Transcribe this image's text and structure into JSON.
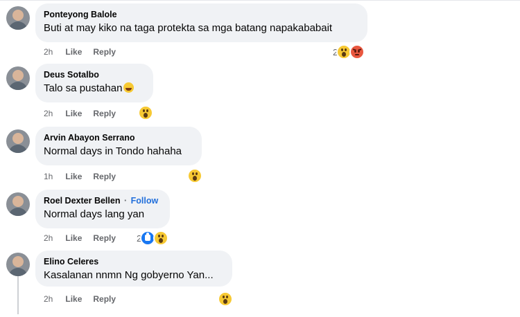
{
  "comments": [
    {
      "author": "Ponteyong Balole",
      "text": "Buti at may kiko na taga protekta sa mga batang napakababait",
      "time": "2h",
      "like": "Like",
      "reply": "Reply",
      "reaction_count": "2",
      "reactions": [
        "wow-emoji-icon",
        "angry-emoji-icon"
      ]
    },
    {
      "author": "Deus Sotalbo",
      "text": "Talo sa pustahan",
      "text_emoji": "laughing-emoji-icon",
      "time": "2h",
      "like": "Like",
      "reply": "Reply",
      "reactions": [
        "wow-emoji-icon"
      ]
    },
    {
      "author": "Arvin Abayon Serrano",
      "text": "Normal days in Tondo hahaha",
      "time": "1h",
      "like": "Like",
      "reply": "Reply",
      "reactions": [
        "wow-emoji-icon"
      ]
    },
    {
      "author": "Roel Dexter Bellen",
      "separator": "·",
      "follow": "Follow",
      "text": "Normal days lang yan",
      "time": "2h",
      "like": "Like",
      "reply": "Reply",
      "reaction_count": "2",
      "reactions": [
        "like-emoji-icon",
        "wow-emoji-icon"
      ]
    },
    {
      "author": "Elino Celeres",
      "text": "Kasalanan nnmn Ng gobyerno Yan...",
      "time": "2h",
      "like": "Like",
      "reply": "Reply",
      "reactions": [
        "wow-emoji-icon"
      ]
    }
  ],
  "colors": {
    "bubble": "#f0f2f5",
    "meta_text": "#65676b",
    "follow": "#216fdb",
    "like_reaction": "#1877f2",
    "wow_reaction": "#f7c933",
    "angry_reaction": "#e9573f"
  }
}
